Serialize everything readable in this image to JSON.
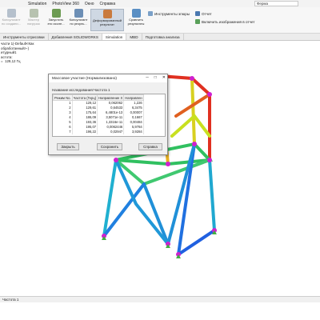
{
  "menu": {
    "items": [
      "Simulation",
      "PhotoView 360",
      "Окно",
      "Справка"
    ],
    "search_value": "Ферма"
  },
  "ribbon": {
    "buttons": [
      {
        "label": "Консультант\nпо создани...",
        "icon": "study-advisor-icon",
        "color": "#b5c0cc",
        "active": false
      },
      {
        "label": "Мастер\nнагрузок",
        "icon": "loads-icon",
        "color": "#b7c2b0",
        "active": false
      },
      {
        "label": "Запустить\nэто иссле...",
        "icon": "run-study-icon",
        "color": "#6c9b52",
        "active": true
      },
      {
        "label": "Консультант\nпо резуль...",
        "icon": "results-advisor-icon",
        "color": "#6d8fb5",
        "active": true
      },
      {
        "label": "Деформированный\nрезультат",
        "icon": "deformed-result-icon",
        "color": "#c97a3d",
        "active": true
      },
      {
        "label": "Сравнить\nрезультаты",
        "icon": "compare-results-icon",
        "color": "#5a8fc4",
        "active": true
      }
    ],
    "small_items": [
      {
        "label": "Инструменты эпюры",
        "icon": "plot-tools-icon"
      },
      {
        "label": "Отчет",
        "icon": "report-icon"
      },
      {
        "label": "Включить изображения в отчет",
        "icon": "include-image-icon"
      }
    ]
  },
  "tabs": [
    "Инструменты отрисовки",
    "Добавления SOLIDWORKS",
    "Simulation",
    "MBD",
    "Подготовка анализа"
  ],
  "active_tab": 2,
  "tree": [
    "части 1(-Default<Как обработанный>-)",
    "итудный1",
    "астота:",
    "=",
    "129,12 Гц"
  ],
  "dialog": {
    "title": "Массовое участие (Нормализовано)",
    "study_label": "Название исследования:Частота 1",
    "columns": [
      "Режим No.",
      "Частота (Герц)",
      "Направление X",
      "Направлен"
    ],
    "rows": [
      [
        "1",
        "129,12",
        "0,062062",
        "1,226"
      ],
      [
        "2",
        "129,61",
        "0,64533",
        "6,3475"
      ],
      [
        "3",
        "175,64",
        "6,4801e-13",
        "0,00007"
      ],
      [
        "4",
        "186,09",
        "3,5071e-11",
        "0,1667"
      ],
      [
        "5",
        "193,36",
        "1,3316e-11",
        "0,00484"
      ],
      [
        "6",
        "195,07",
        "0,0062446",
        "5,9784"
      ],
      [
        "7",
        "196,22",
        "0,02947",
        "3,9284"
      ]
    ],
    "buttons": {
      "close": "Закрыть",
      "save": "Сохранить",
      "help": "Справка"
    }
  },
  "status": {
    "text": "Частота 1"
  },
  "colors": {
    "ribbon_bg": "#f7f7f7",
    "beam_red": "#e02020",
    "beam_yellow": "#d8e020",
    "beam_green": "#30c060",
    "beam_cyan": "#20b8d0",
    "beam_blue": "#2050e0",
    "joint_magenta": "#d020d0"
  }
}
